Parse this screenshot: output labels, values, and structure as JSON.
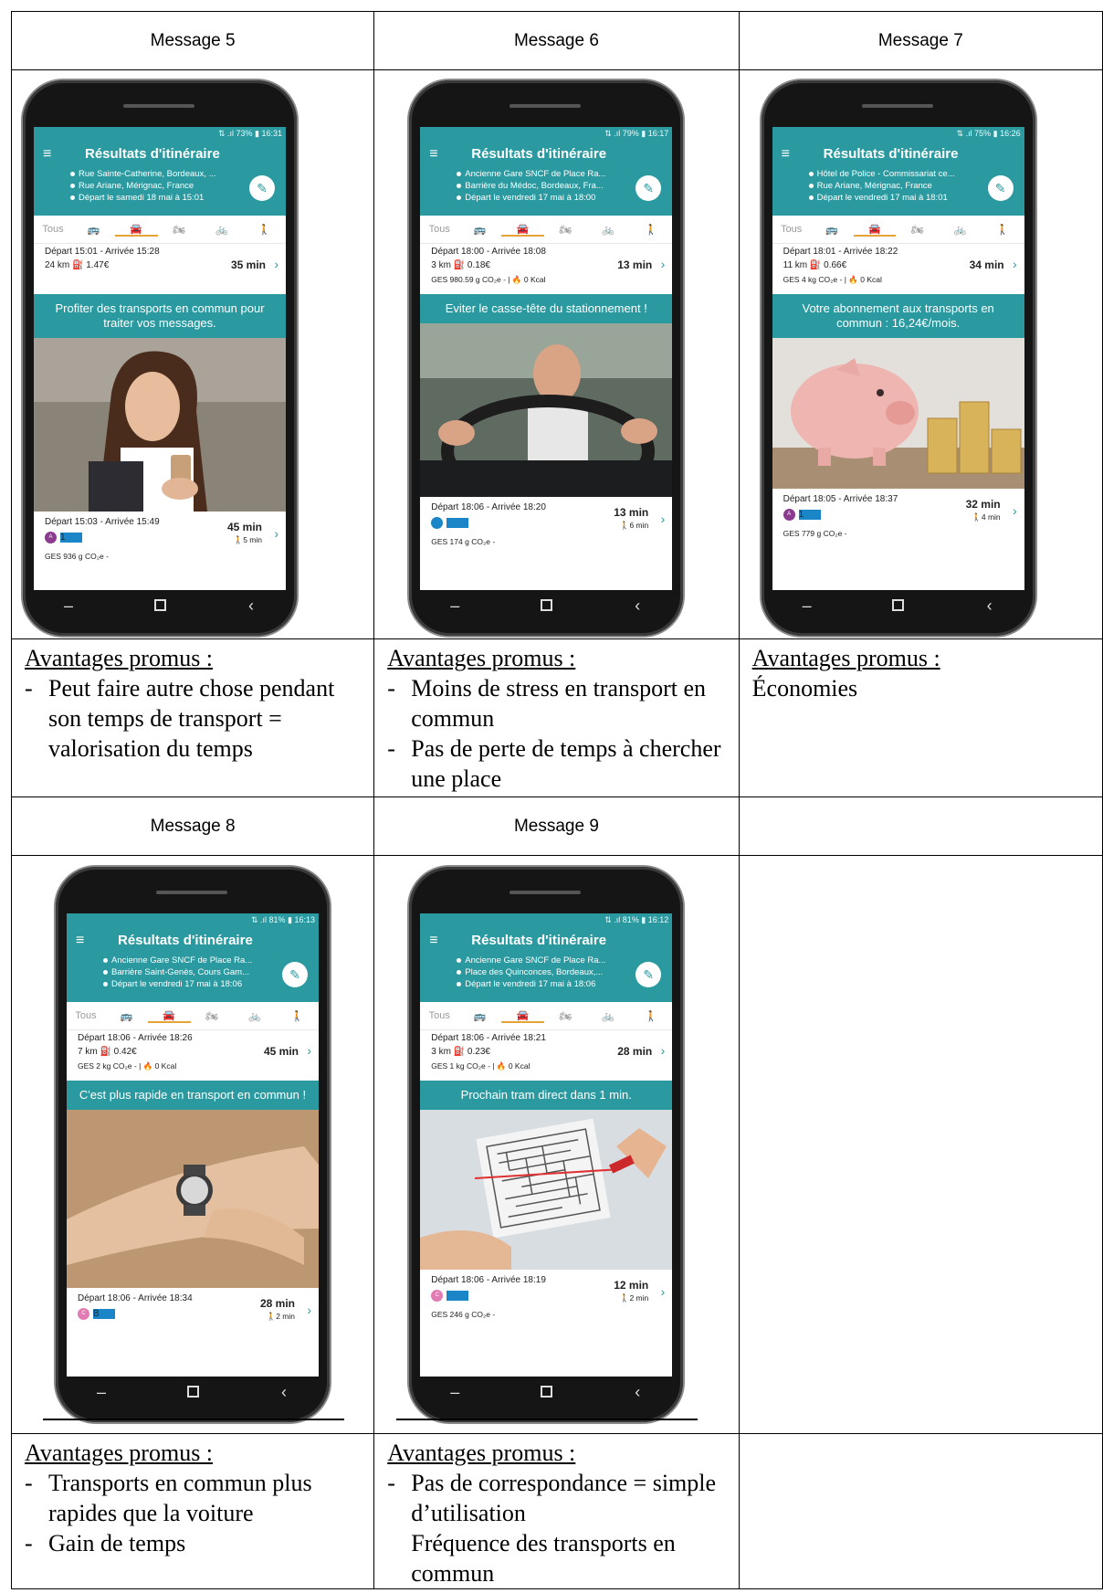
{
  "headers": [
    "Message 5",
    "Message 6",
    "Message 7",
    "Message 8",
    "Message 9"
  ],
  "labels": {
    "advantages_title": "Avantages promus :"
  },
  "app_common": {
    "app_title": "Résultats d'itinéraire",
    "mode_all": "Tous",
    "menu_glyph": "≡",
    "edit_glyph": "✎",
    "nav_back": "‹",
    "nav_recent": "–"
  },
  "phones": [
    {
      "status": "⇅ .ıl 73% ▮ 16:31",
      "from": "Rue Sainte-Catherine, Bordeaux, ...",
      "to": "Rue Ariane, Mérignac, France",
      "when": "Départ le samedi 18 mai à 15:01",
      "car_times": "Départ 15:01 - Arrivée 15:28",
      "car_cost": "24 km ⛽ 1.47€",
      "car_duration": "35 min",
      "car_ges": "",
      "bubble": "Profiter des transports en commun pour traiter vos messages.",
      "alt_times": "Départ 15:03 - Arrivée 15:49",
      "alt_duration": "45 min",
      "alt_walk": "🚶5 min",
      "alt_ges": "GES 936 g CO₂e -",
      "photo": "woman-phone-photo",
      "badge1": "A",
      "badge1_color": "#8b3a8f",
      "badge2": "1"
    },
    {
      "status": "⇅ .ıl 79% ▮ 16:17",
      "from": "Ancienne Gare SNCF de Place Ra...",
      "to": "Barrière du Médoc, Bordeaux, Fra...",
      "when": "Départ le vendredi 17 mai à 18:00",
      "car_times": "Départ 18:00 - Arrivée 18:08",
      "car_cost": "3 km ⛽ 0.18€",
      "car_duration": "13 min",
      "car_ges": "GES 980.59 g CO₂e - | 🔥 0 Kcal",
      "bubble": "Eviter le casse-tête du stationnement !",
      "alt_times": "Départ 18:06 - Arrivée 18:20",
      "alt_duration": "13 min",
      "alt_walk": "🚶6 min",
      "alt_ges": "GES 174 g CO₂e -",
      "photo": "stressed-driver-photo",
      "badge1": "",
      "badge1_color": "#1a86c8",
      "badge2": ""
    },
    {
      "status": "⇅ .ıl 75% ▮ 16:26",
      "from": "Hôtel de Police - Commissariat ce...",
      "to": "Rue Ariane, Mérignac, France",
      "when": "Départ le vendredi 17 mai à 18:01",
      "car_times": "Départ 18:01 - Arrivée 18:22",
      "car_cost": "11 km ⛽ 0.66€",
      "car_duration": "34 min",
      "car_ges": "GES 4 kg CO₂e - | 🔥 0 Kcal",
      "bubble": "Votre abonnement aux transports en commun : 16,24€/mois.",
      "alt_times": "Départ 18:05 - Arrivée 18:37",
      "alt_duration": "32 min",
      "alt_walk": "🚶4 min",
      "alt_ges": "GES 779 g CO₂e -",
      "photo": "piggy-bank-photo",
      "badge1": "A",
      "badge1_color": "#8b3a8f",
      "badge2": "1"
    },
    {
      "status": "⇅ .ıl 81% ▮ 16:13",
      "from": "Ancienne Gare SNCF de Place Ra...",
      "to": "Barrière Saint-Genès, Cours Gam...",
      "when": "Départ le vendredi 17 mai à 18:06",
      "car_times": "Départ 18:06 - Arrivée 18:26",
      "car_cost": "7 km ⛽ 0.42€",
      "car_duration": "45 min",
      "car_ges": "GES 2 kg CO₂e - | 🔥 0 Kcal",
      "bubble": "C'est plus rapide en transport en commun !",
      "alt_times": "Départ 18:06 - Arrivée 18:34",
      "alt_duration": "28 min",
      "alt_walk": "🚶2 min",
      "alt_ges": "",
      "photo": "wristwatch-photo",
      "badge1": "C",
      "badge1_color": "#e27bb4",
      "badge2": "B"
    },
    {
      "status": "⇅ .ıl 81% ▮ 16:12",
      "from": "Ancienne Gare SNCF de Place Ra...",
      "to": "Place des Quinconces, Bordeaux,...",
      "when": "Départ le vendredi 17 mai à 18:06",
      "car_times": "Départ 18:06 - Arrivée 18:21",
      "car_cost": "3 km ⛽ 0.23€",
      "car_duration": "28 min",
      "car_ges": "GES 1 kg CO₂e - | 🔥 0 Kcal",
      "bubble": "Prochain tram direct dans 1 min.",
      "alt_times": "Départ 18:06 - Arrivée 18:19",
      "alt_duration": "12 min",
      "alt_walk": "🚶2 min",
      "alt_ges": "GES 246 g CO₂e -",
      "photo": "maze-photo",
      "badge1": "C",
      "badge1_color": "#e27bb4",
      "badge2": ""
    }
  ],
  "advantages": [
    {
      "bullets": [
        "Peut faire autre chose pendant son temps de transport = valorisation du temps"
      ]
    },
    {
      "bullets": [
        "Moins de stress en transport en commun",
        "Pas de perte de temps à chercher une place"
      ]
    },
    {
      "plain": "Économies"
    },
    {
      "bullets": [
        "Transports en commun plus rapides que la voiture",
        "Gain de temps"
      ]
    },
    {
      "bullets": [
        "Pas de correspondance = simple d’utilisation"
      ],
      "continuation": [
        "Fréquence des transports en",
        "commun"
      ]
    }
  ]
}
